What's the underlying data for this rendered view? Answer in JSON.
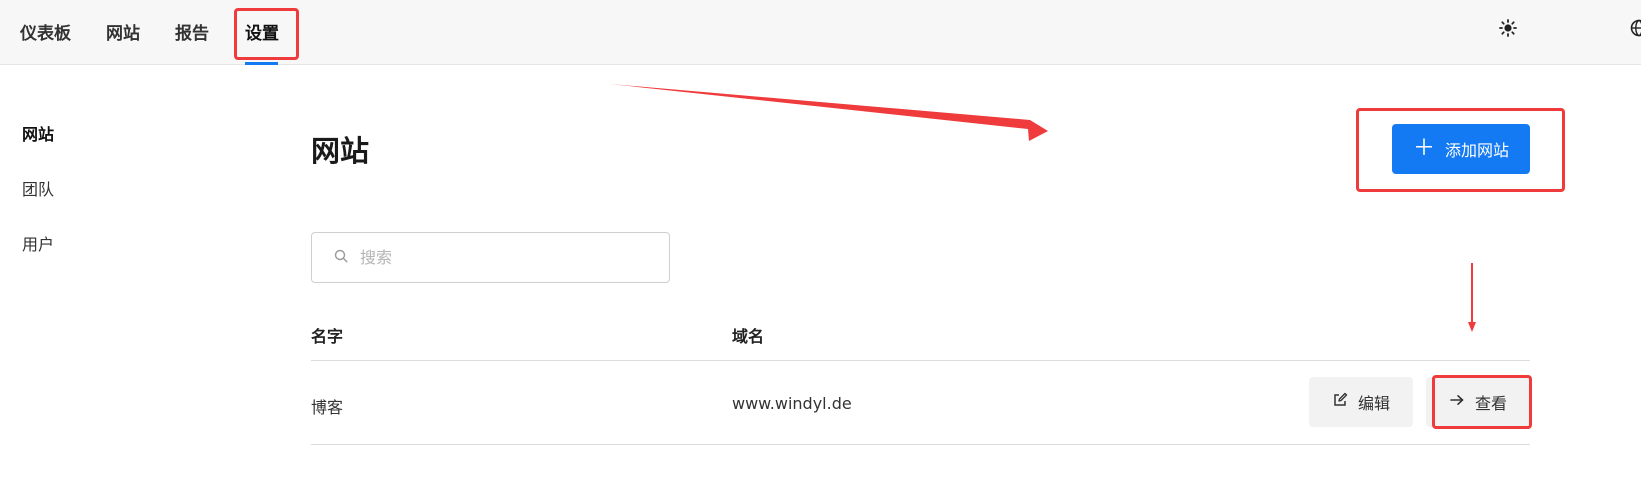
{
  "topnav": {
    "items": [
      {
        "label": "仪表板"
      },
      {
        "label": "网站"
      },
      {
        "label": "报告"
      },
      {
        "label": "设置"
      }
    ],
    "active_index": 3,
    "icons": [
      "sun-icon",
      "globe-icon"
    ]
  },
  "sidebar": {
    "items": [
      {
        "label": "网站"
      },
      {
        "label": "团队"
      },
      {
        "label": "用户"
      }
    ],
    "active_index": 0
  },
  "main": {
    "title": "网站",
    "add_button_label": "添加网站",
    "search_placeholder": "搜索",
    "columns": [
      "名字",
      "域名"
    ],
    "rows": [
      {
        "name": "博客",
        "domain": "www.windyl.de",
        "edit_label": "编辑",
        "view_label": "查看"
      }
    ]
  },
  "colors": {
    "accent": "#147af3",
    "annotation": "#ef3b3b"
  }
}
